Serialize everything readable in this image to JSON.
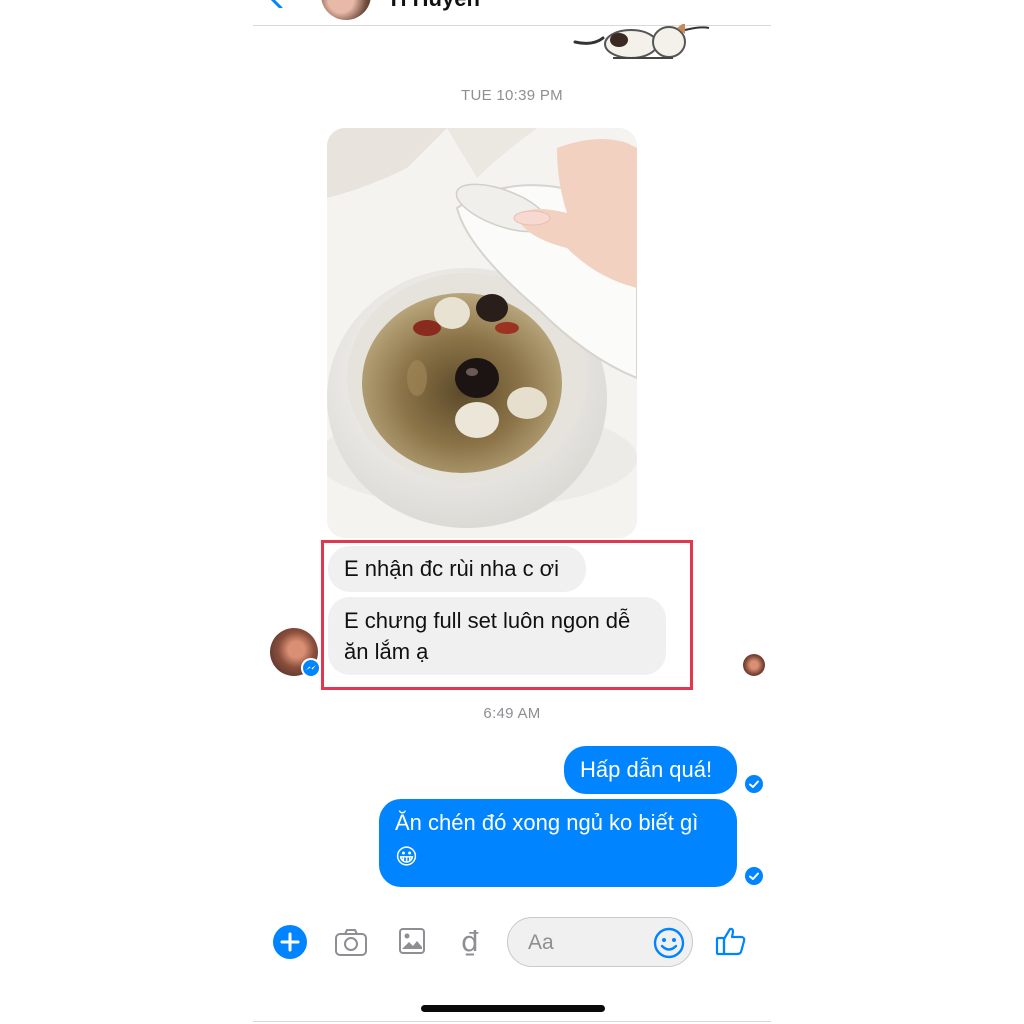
{
  "header": {
    "contact_name": "Tí Huyền"
  },
  "conversation": {
    "timestamp_1": "TUE 10:39 PM",
    "incoming_messages": [
      "E nhận đc rùi nha c ơi",
      "E chưng full set luôn ngon dễ ăn lắm ạ"
    ],
    "timestamp_2": "6:49 AM",
    "outgoing_messages": [
      "Hấp dẫn quá!",
      "Ăn chén đó xong ngủ ko biết gì",
      "😀"
    ]
  },
  "composer": {
    "placeholder": "Aa",
    "currency_symbol": "₫"
  },
  "icons": {
    "back": "chevron-left-icon",
    "plus": "plus-circle-icon",
    "camera": "camera-icon",
    "gallery": "image-icon",
    "payment": "dong-icon",
    "emoji": "smiley-icon",
    "like": "thumbs-up-icon",
    "sent": "check-circle-icon",
    "messenger": "messenger-badge-icon"
  },
  "colors": {
    "accent": "#0084ff",
    "incoming_bubble": "#f0f0f0",
    "highlight": "#e2374f"
  }
}
